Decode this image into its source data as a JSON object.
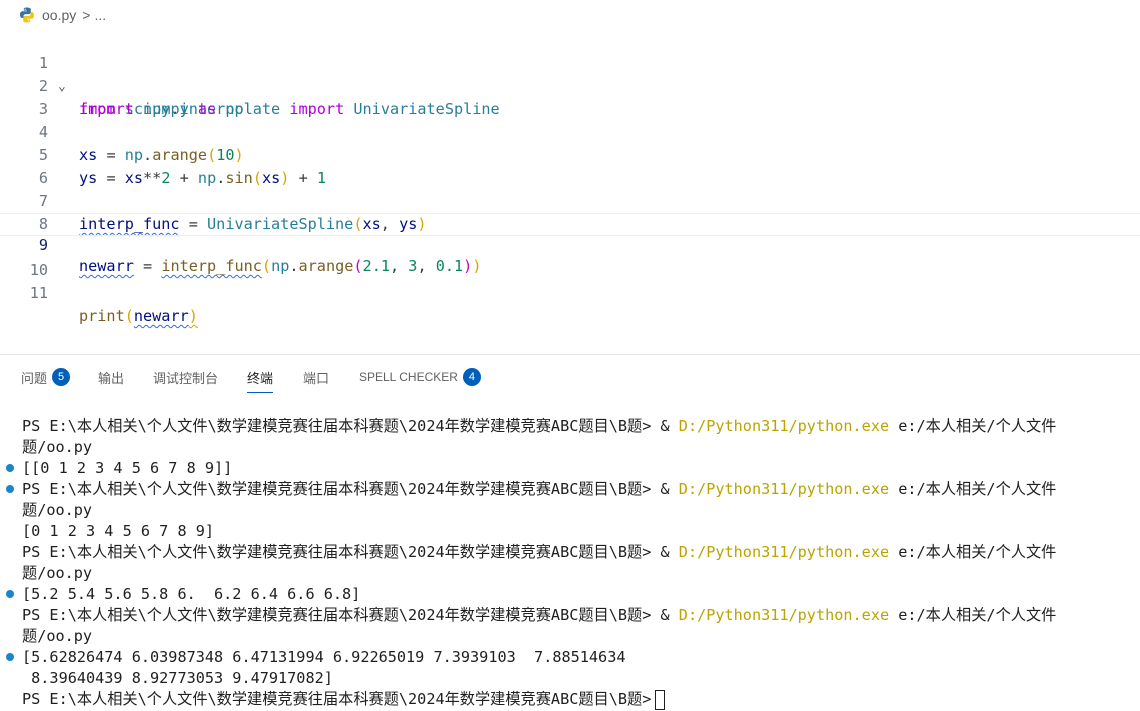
{
  "breadcrumb": {
    "file": "oo.py",
    "sep": ">",
    "rest": "..."
  },
  "editor": {
    "line_numbers": [
      "1",
      "2",
      "3",
      "4",
      "5",
      "6",
      "7",
      "8",
      "9",
      "10",
      "11"
    ],
    "l1": {
      "a": "from",
      "b": "scipy",
      "c": ".",
      "d": "interpolate",
      "e": "import",
      "f": "UnivariateSpline"
    },
    "l2": {
      "a": "import",
      "b": "numpy",
      "c": "as",
      "d": "np"
    },
    "l4": {
      "a": "xs",
      "b": " = ",
      "c": "np",
      "d": ".",
      "e": "arange",
      "f": "(",
      "g": "10",
      "h": ")"
    },
    "l5": {
      "a": "ys",
      "b": " = ",
      "c": "xs",
      "d": "**",
      "e": "2",
      "f": " + ",
      "g": "np",
      "h": ".",
      "i": "sin",
      "j": "(",
      "k": "xs",
      "l": ")",
      "m": " + ",
      "n": "1"
    },
    "l7": {
      "a": "interp_func",
      "b": " = ",
      "c": "UnivariateSpline",
      "d": "(",
      "e": "xs",
      "f": ", ",
      "g": "ys",
      "h": ")"
    },
    "l9": {
      "a": "newarr",
      "b": " = ",
      "c": "interp_func",
      "d": "(",
      "e": "np",
      "f": ".",
      "g": "arange",
      "h": "(",
      "i": "2.1",
      "j": ", ",
      "k": "3",
      "l": ", ",
      "m": "0.1",
      "n": ")",
      "o": ")"
    },
    "l11": {
      "a": "print",
      "b": "(",
      "c": "newarr",
      "d": ")"
    }
  },
  "panel": {
    "tabs": [
      {
        "label": "问题",
        "badge": "5"
      },
      {
        "label": "输出"
      },
      {
        "label": "调试控制台"
      },
      {
        "label": "终端"
      },
      {
        "label": "端口"
      },
      {
        "label": "SPELL CHECKER",
        "badge": "4"
      }
    ]
  },
  "terminal": {
    "prompt": "PS E:\\本人相关\\个人文件\\数学建模竞赛往届本科赛题\\2024年数学建模竞赛ABC题目\\B题> ",
    "amp": "& ",
    "exe": "D:/Python311/python.exe",
    "arg": " e:/本人相关/个人文件",
    "cont": "题/oo.py",
    "out1": "[[0 1 2 3 4 5 6 7 8 9]]",
    "out2": "[0 1 2 3 4 5 6 7 8 9]",
    "out3": "[5.2 5.4 5.6 5.8 6.  6.2 6.4 6.6 6.8]",
    "out4a": "[5.62826474 6.03987348 6.47131994 6.92265019 7.3939103  7.88514634",
    "out4b": " 8.39640439 8.92773053 9.47917082]",
    "last_prompt": "PS E:\\本人相关\\个人文件\\数学建模竞赛往届本科赛题\\2024年数学建模竞赛ABC题目\\B题>"
  },
  "colors": {
    "accent": "#005fb8",
    "keyword": "#af00db",
    "module": "#267f99",
    "function": "#795e26",
    "variable": "#001080",
    "number": "#098658",
    "dot": "#1a85c7"
  }
}
